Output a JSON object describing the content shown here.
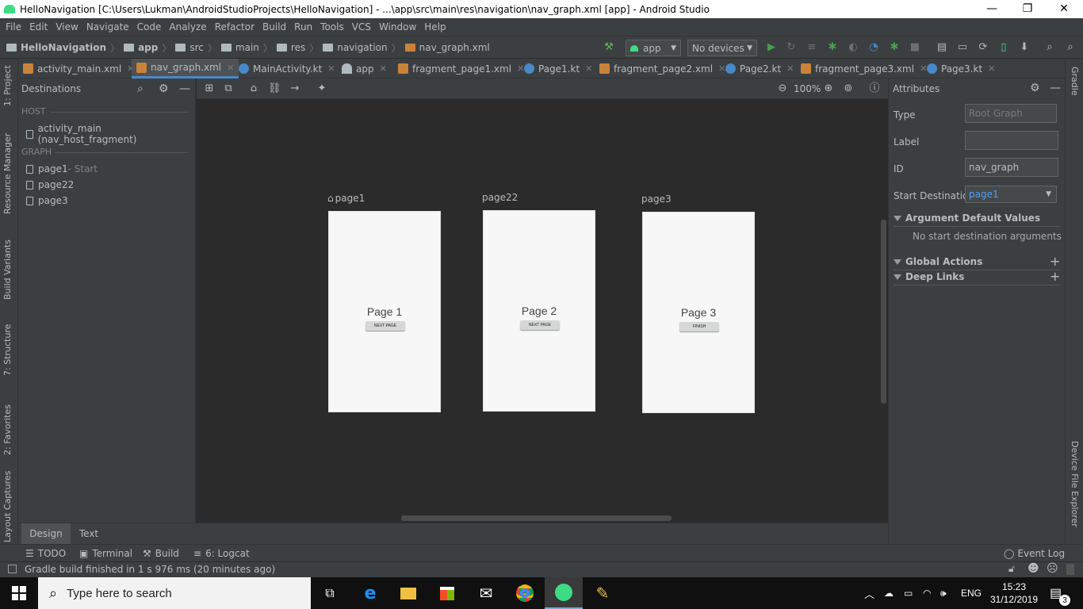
{
  "window": {
    "title": "HelloNavigation [C:\\Users\\Lukman\\AndroidStudioProjects\\HelloNavigation] - ...\\app\\src\\main\\res\\navigation\\nav_graph.xml [app] - Android Studio",
    "minimize": "—",
    "restore": "❐",
    "close": "✕"
  },
  "menu": [
    "File",
    "Edit",
    "View",
    "Navigate",
    "Code",
    "Analyze",
    "Refactor",
    "Build",
    "Run",
    "Tools",
    "VCS",
    "Window",
    "Help"
  ],
  "breadcrumb": {
    "project": "HelloNavigation",
    "app": "app",
    "src": "src",
    "main": "main",
    "res": "res",
    "navigation": "navigation",
    "file": "nav_graph.xml"
  },
  "toolbar": {
    "config": "app",
    "devices": "No devices"
  },
  "tabs": [
    {
      "label": "activity_main.xml",
      "icon": "layout-xml-icon",
      "active": false
    },
    {
      "label": "nav_graph.xml",
      "icon": "nav-xml-icon",
      "active": true
    },
    {
      "label": "MainActivity.kt",
      "icon": "kotlin-class-icon",
      "active": false
    },
    {
      "label": "app",
      "icon": "android-module-icon",
      "active": false
    },
    {
      "label": "fragment_page1.xml",
      "icon": "layout-xml-icon",
      "active": false
    },
    {
      "label": "Page1.kt",
      "icon": "kotlin-class-icon",
      "active": false
    },
    {
      "label": "fragment_page2.xml",
      "icon": "layout-xml-icon",
      "active": false
    },
    {
      "label": "Page2.kt",
      "icon": "kotlin-class-icon",
      "active": false
    },
    {
      "label": "fragment_page3.xml",
      "icon": "layout-xml-icon",
      "active": false
    },
    {
      "label": "Page3.kt",
      "icon": "kotlin-class-icon",
      "active": false
    }
  ],
  "left_tools": [
    "1: Project",
    "Resource Manager",
    "Build Variants",
    "7: Structure",
    "2: Favorites",
    "Layout Captures"
  ],
  "right_tools": [
    "Gradle",
    "Device File Explorer"
  ],
  "destinations": {
    "title": "Destinations",
    "host_header": "HOST",
    "host_item": "activity_main (nav_host_fragment)",
    "graph_header": "GRAPH",
    "items": [
      {
        "name": "page1",
        "suffix": " - Start"
      },
      {
        "name": "page22",
        "suffix": ""
      },
      {
        "name": "page3",
        "suffix": ""
      }
    ]
  },
  "editor": {
    "zoom": "100%",
    "screens": [
      {
        "label": "page1",
        "title": "Page 1",
        "button": "NEXT PAGE",
        "is_start": true
      },
      {
        "label": "page22",
        "title": "Page 2",
        "button": "NEXT PAGE",
        "is_start": false
      },
      {
        "label": "page3",
        "title": "Page 3",
        "button": "FINISH",
        "is_start": false
      }
    ]
  },
  "attributes": {
    "title": "Attributes",
    "type_label": "Type",
    "type_value": "Root Graph",
    "label_label": "Label",
    "label_value": "",
    "id_label": "ID",
    "id_value": "nav_graph",
    "start_label": "Start Destinatior",
    "start_value": "page1",
    "arg_section": "Argument Default Values",
    "arg_empty": "No start destination arguments",
    "global_actions": "Global Actions",
    "deep_links": "Deep Links"
  },
  "design_tabs": {
    "design": "Design",
    "text": "Text"
  },
  "tool_windows": [
    {
      "label": "TODO",
      "icon": "list-icon"
    },
    {
      "label": "Terminal",
      "icon": "terminal-icon"
    },
    {
      "label": "Build",
      "icon": "hammer-icon"
    },
    {
      "label": "6: Logcat",
      "icon": "logcat-icon"
    }
  ],
  "event_log": "Event Log",
  "status": "Gradle build finished in 1 s 976 ms (20 minutes ago)",
  "taskbar": {
    "search_placeholder": "Type here to search",
    "lang": "ENG",
    "time": "15:23",
    "date": "31/12/2019",
    "notifications": "3"
  },
  "colors": {
    "accent": "#4a88c7",
    "run_green": "#499c54",
    "android_green": "#3ddc84"
  }
}
